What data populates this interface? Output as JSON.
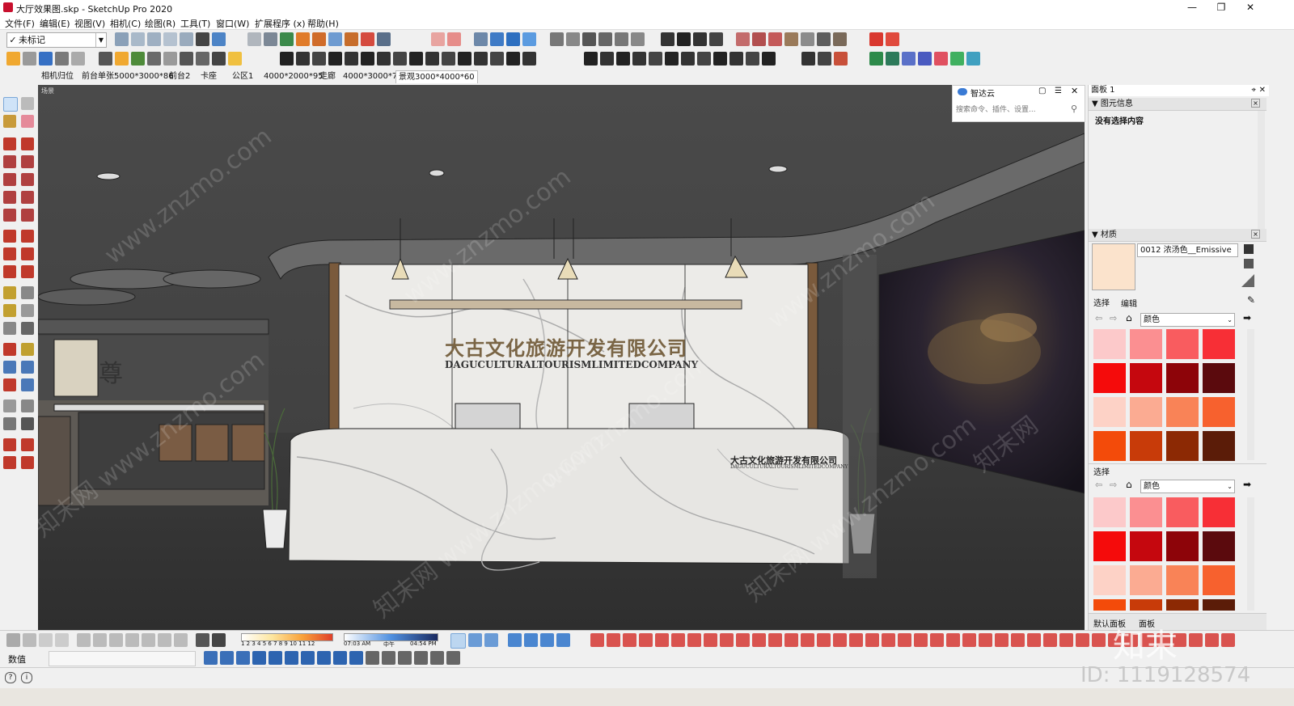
{
  "window": {
    "title": "大厅效果图.skp - SketchUp Pro 2020",
    "minimize": "—",
    "maximize": "❐",
    "close": "✕"
  },
  "menu": [
    "文件(F)",
    "编辑(E)",
    "视图(V)",
    "相机(C)",
    "绘图(R)",
    "工具(T)",
    "窗口(W)",
    "扩展程序 (x)",
    "帮助(H)"
  ],
  "toolbar": {
    "layer_select": "未标记",
    "layer_check": "✓"
  },
  "scene_tabs": [
    "相机归位",
    "前台单张5000*3000*86",
    "前台2",
    "卡座",
    "公区1",
    "4000*2000*95",
    "走廊",
    "4000*3000*70",
    "景观3000*4000*60"
  ],
  "active_scene_index": 8,
  "viewport": {
    "scene_label": "场景",
    "logo_cn": "大古文化旅游开发有限公司",
    "logo_en": "DAGUCULTURALTOURISMLIMITEDCOMPANY",
    "desk_logo_cn": "大古文化旅游开发有限公司",
    "desk_logo_en": "DAGUCULTURALTOURISMLIMITEDCOMPANY",
    "wall_character": "尊"
  },
  "search_panel": {
    "title": "智达云",
    "placeholder": "搜索命令、插件、设置..."
  },
  "right_panel": {
    "tray_title": "面板 1",
    "entity_info_header": "图元信息",
    "entity_info_text": "没有选择内容",
    "materials_header": "材质",
    "material_name": "0012 浓汤色__Emissive",
    "material_swatch_color": "#fbe3cc",
    "tab_select": "选择",
    "tab_edit": "编辑",
    "color_dropdown": "颜色",
    "select2_label": "选择",
    "color_dropdown2": "颜色",
    "footer_tab1": "默认面板",
    "footer_tab2": "面板",
    "swatches_top": [
      "#fcc9ca",
      "#fb8f91",
      "#f95c5f",
      "#f72f36",
      "#f50b0b",
      "#c5070e",
      "#8d0409",
      "#5b0a0d",
      "#fdd2c6",
      "#fbab92",
      "#f98357",
      "#f7612e",
      "#f34b0a",
      "#c83b09",
      "#8c2904",
      "#5b1c08"
    ],
    "swatches_bottom": [
      "#fcc9ca",
      "#fb8f91",
      "#f95c5f",
      "#f72f36",
      "#f50b0b",
      "#c5070e",
      "#8d0409",
      "#5b0a0d",
      "#fdd2c6",
      "#fbab92",
      "#f98357",
      "#f7612e",
      "#f34b0a",
      "#c83b09",
      "#8c2904",
      "#5b1c08"
    ]
  },
  "statusbar": {
    "time_start": "07:03 AM",
    "time_mid": "中午",
    "time_end": "04:54 PM",
    "months": "1 2 3 4 5 6 7 8 9 10 11 12"
  },
  "measurements": {
    "label": "数值"
  },
  "brand": {
    "logo_text": "知末",
    "id_text": "ID: 1119128574"
  },
  "watermarks": [
    "www.znzmo.com",
    "知末网 www.znzmo.com",
    "www.znzmo.com",
    "知末网 www.znzmo.com",
    "www.znzmo.com",
    "知末网 www.znzmo.com",
    "www.znzmo.com",
    "知末网"
  ]
}
